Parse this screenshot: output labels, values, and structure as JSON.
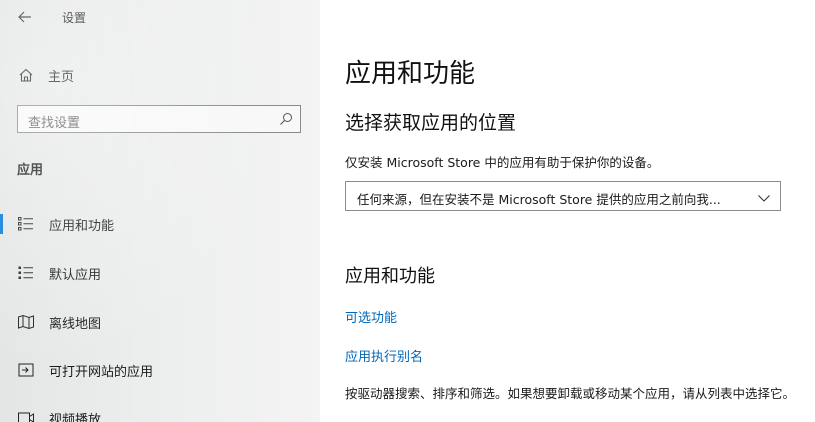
{
  "window": {
    "title": "设置"
  },
  "sidebar": {
    "home_label": "主页",
    "search_placeholder": "查找设置",
    "section_title": "应用",
    "items": [
      {
        "label": "应用和功能",
        "icon": "apps-features-icon",
        "selected": true
      },
      {
        "label": "默认应用",
        "icon": "default-apps-icon",
        "selected": false
      },
      {
        "label": "离线地图",
        "icon": "offline-maps-icon",
        "selected": false
      },
      {
        "label": "可打开网站的应用",
        "icon": "apps-for-websites-icon",
        "selected": false
      },
      {
        "label": "视频播放",
        "icon": "video-playback-icon",
        "selected": false
      }
    ]
  },
  "main": {
    "page_title": "应用和功能",
    "install_section_title": "选择获取应用的位置",
    "install_description": "仅安装 Microsoft Store 中的应用有助于保护你的设备。",
    "install_source_selected": "任何来源，但在安装不是 Microsoft Store 提供的应用之前向我...",
    "apps_section_title": "应用和功能",
    "links": {
      "optional_features": "可选功能",
      "app_execution_aliases": "应用执行别名"
    },
    "apps_description": "按驱动器搜索、排序和筛选。如果想要卸载或移动某个应用，请从列表中选择它。"
  },
  "colors": {
    "accent": "#0078d7",
    "link": "#0067b8",
    "sidebar_bg": "#eceeed"
  }
}
